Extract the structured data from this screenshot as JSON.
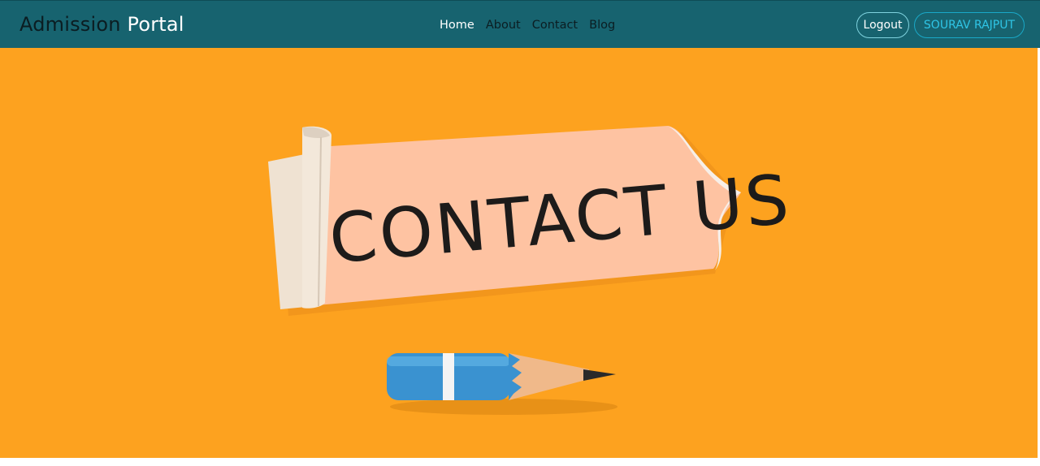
{
  "navbar": {
    "brand_part1": "Admission",
    "brand_part2": "Portal",
    "links": [
      {
        "label": "Home",
        "active": true
      },
      {
        "label": "About",
        "active": false
      },
      {
        "label": "Contact",
        "active": false
      },
      {
        "label": "Blog",
        "active": false
      }
    ],
    "logout_label": "Logout",
    "user_label": "SOURAV RAJPUT"
  },
  "hero": {
    "banner_text": "CONTACT US"
  },
  "colors": {
    "navbar_bg": "#17636f",
    "hero_bg": "#fda21f",
    "paper": "#fec3a2",
    "pencil_blue": "#3a92d0"
  },
  "icons": [
    "pencil-icon"
  ]
}
